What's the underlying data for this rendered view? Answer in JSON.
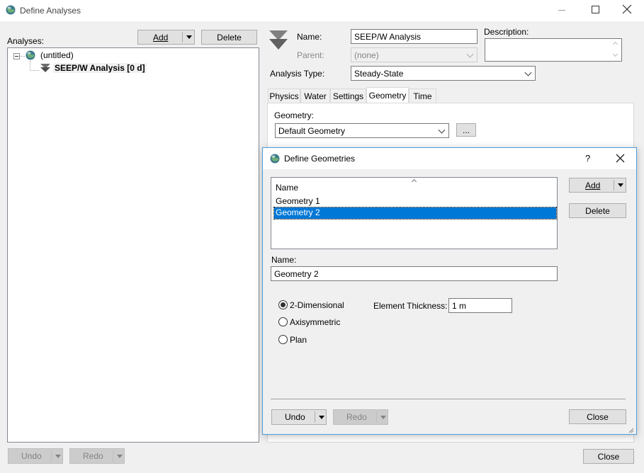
{
  "window": {
    "title": "Define Analyses"
  },
  "analyses": {
    "label": "Analyses:",
    "add_label": "Add",
    "delete_label": "Delete",
    "tree": {
      "root_label": "(untitled)",
      "child_label": "SEEP/W Analysis [0 d]"
    }
  },
  "form": {
    "name_label": "Name:",
    "name_value": "SEEP/W Analysis",
    "parent_label": "Parent:",
    "parent_value": "(none)",
    "description_label": "Description:",
    "description_value": "",
    "analysis_type_label": "Analysis Type:",
    "analysis_type_value": "Steady-State"
  },
  "tabs": [
    {
      "label": "Physics"
    },
    {
      "label": "Water"
    },
    {
      "label": "Settings"
    },
    {
      "label": "Geometry"
    },
    {
      "label": "Time"
    }
  ],
  "geometry_tab": {
    "geometry_label": "Geometry:",
    "geometry_value": "Default Geometry",
    "browse_label": "..."
  },
  "bottom": {
    "undo_label": "Undo",
    "redo_label": "Redo",
    "close_label": "Close"
  },
  "dialog": {
    "title": "Define Geometries",
    "help_label": "?",
    "list_header": "Name",
    "items": [
      {
        "label": "Geometry 1",
        "selected": false
      },
      {
        "label": "Geometry 2",
        "selected": true
      }
    ],
    "add_label": "Add",
    "delete_label": "Delete",
    "name_label": "Name:",
    "name_value": "Geometry 2",
    "options": [
      {
        "label": "2-Dimensional",
        "checked": true
      },
      {
        "label": "Axisymmetric",
        "checked": false
      },
      {
        "label": "Plan",
        "checked": false
      }
    ],
    "thickness_label": "Element Thickness:",
    "thickness_value": "1 m",
    "undo_label": "Undo",
    "redo_label": "Redo",
    "close_label": "Close"
  },
  "colors": {
    "selection": "#0078d7",
    "dialog_border": "#4a9ee0",
    "background": "#f0f0f0"
  }
}
